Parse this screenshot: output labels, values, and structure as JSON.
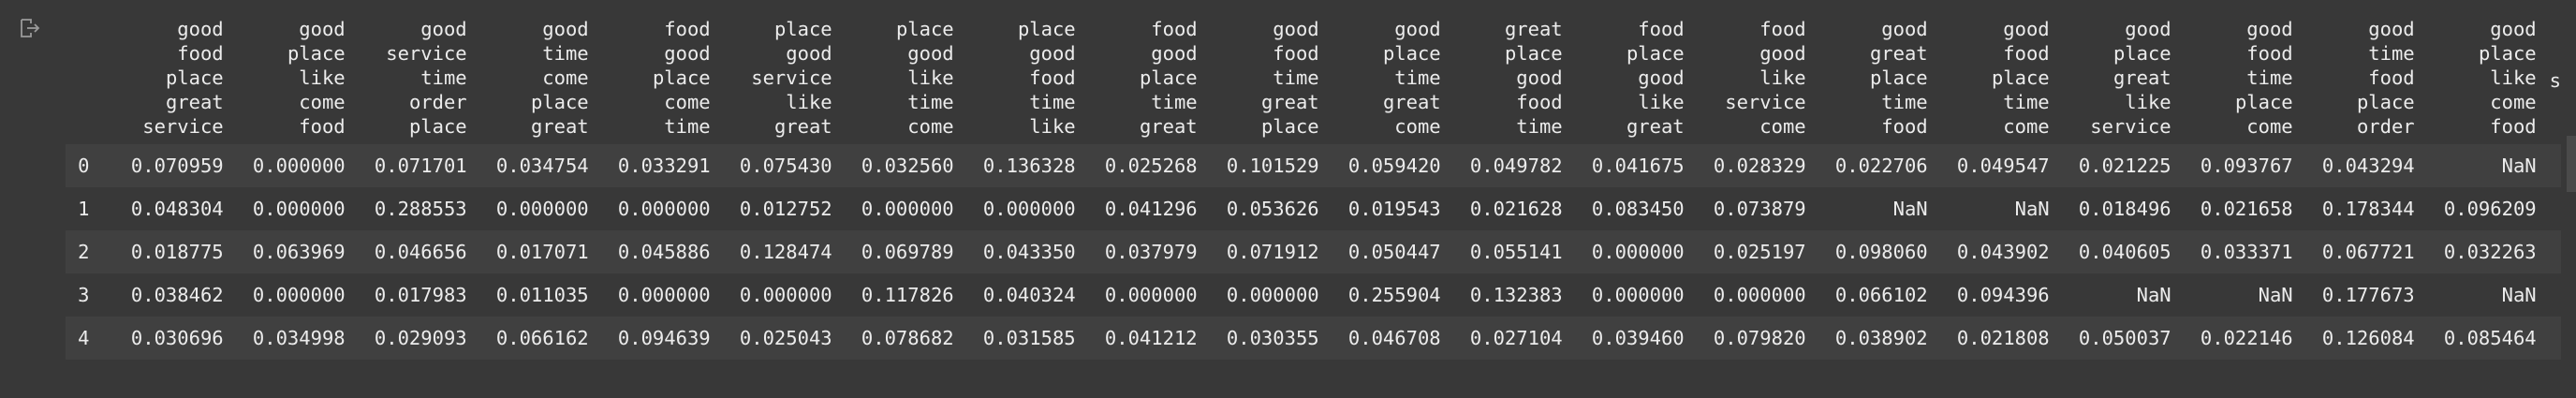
{
  "output_icon": "output-redirect-icon",
  "table": {
    "columns": [
      [
        "good",
        "food",
        "place",
        "great",
        "service"
      ],
      [
        "good",
        "place",
        "like",
        "come",
        "food"
      ],
      [
        "good",
        "service",
        "time",
        "order",
        "place"
      ],
      [
        "good",
        "time",
        "come",
        "place",
        "great"
      ],
      [
        "food",
        "good",
        "place",
        "come",
        "time"
      ],
      [
        "place",
        "good",
        "service",
        "like",
        "great"
      ],
      [
        "place",
        "good",
        "like",
        "time",
        "come"
      ],
      [
        "place",
        "good",
        "food",
        "time",
        "like"
      ],
      [
        "food",
        "good",
        "place",
        "time",
        "great"
      ],
      [
        "good",
        "food",
        "time",
        "great",
        "place"
      ],
      [
        "good",
        "place",
        "time",
        "great",
        "come"
      ],
      [
        "great",
        "place",
        "good",
        "food",
        "time"
      ],
      [
        "food",
        "place",
        "good",
        "like",
        "great"
      ],
      [
        "food",
        "good",
        "like",
        "service",
        "come"
      ],
      [
        "good",
        "great",
        "place",
        "time",
        "food"
      ],
      [
        "good",
        "food",
        "place",
        "time",
        "come"
      ],
      [
        "good",
        "place",
        "great",
        "like",
        "service"
      ],
      [
        "good",
        "food",
        "time",
        "place",
        "come"
      ],
      [
        "good",
        "time",
        "food",
        "place",
        "order"
      ],
      [
        "good",
        "place",
        "like",
        "come",
        "food"
      ]
    ],
    "truncated_marker": "s",
    "rows": [
      {
        "index": "0",
        "values": [
          "0.070959",
          "0.000000",
          "0.071701",
          "0.034754",
          "0.033291",
          "0.075430",
          "0.032560",
          "0.136328",
          "0.025268",
          "0.101529",
          "0.059420",
          "0.049782",
          "0.041675",
          "0.028329",
          "0.022706",
          "0.049547",
          "0.021225",
          "0.093767",
          "0.043294",
          "NaN"
        ]
      },
      {
        "index": "1",
        "values": [
          "0.048304",
          "0.000000",
          "0.288553",
          "0.000000",
          "0.000000",
          "0.012752",
          "0.000000",
          "0.000000",
          "0.041296",
          "0.053626",
          "0.019543",
          "0.021628",
          "0.083450",
          "0.073879",
          "NaN",
          "NaN",
          "0.018496",
          "0.021658",
          "0.178344",
          "0.096209"
        ]
      },
      {
        "index": "2",
        "values": [
          "0.018775",
          "0.063969",
          "0.046656",
          "0.017071",
          "0.045886",
          "0.128474",
          "0.069789",
          "0.043350",
          "0.037979",
          "0.071912",
          "0.050447",
          "0.055141",
          "0.000000",
          "0.025197",
          "0.098060",
          "0.043902",
          "0.040605",
          "0.033371",
          "0.067721",
          "0.032263"
        ]
      },
      {
        "index": "3",
        "values": [
          "0.038462",
          "0.000000",
          "0.017983",
          "0.011035",
          "0.000000",
          "0.000000",
          "0.117826",
          "0.040324",
          "0.000000",
          "0.000000",
          "0.255904",
          "0.132383",
          "0.000000",
          "0.000000",
          "0.066102",
          "0.094396",
          "NaN",
          "NaN",
          "0.177673",
          "NaN"
        ]
      },
      {
        "index": "4",
        "values": [
          "0.030696",
          "0.034998",
          "0.029093",
          "0.066162",
          "0.094639",
          "0.025043",
          "0.078682",
          "0.031585",
          "0.041212",
          "0.030355",
          "0.046708",
          "0.027104",
          "0.039460",
          "0.079820",
          "0.038902",
          "0.021808",
          "0.050037",
          "0.022146",
          "0.126084",
          "0.085464"
        ]
      }
    ]
  }
}
